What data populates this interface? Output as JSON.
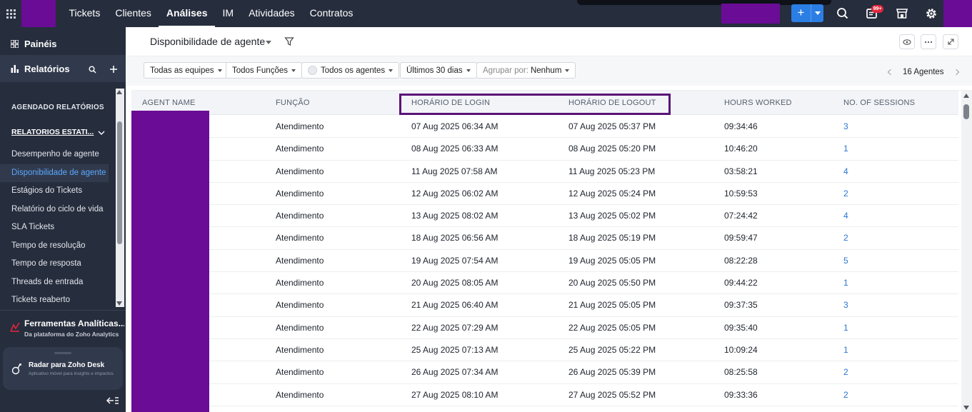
{
  "topbar": {
    "nav": [
      {
        "label": "Tickets",
        "active": false
      },
      {
        "label": "Clientes",
        "active": false
      },
      {
        "label": "Análises",
        "active": true
      },
      {
        "label": "IM",
        "active": false
      },
      {
        "label": "Atividades",
        "active": false
      },
      {
        "label": "Contratos",
        "active": false
      }
    ],
    "new_button": "+",
    "notification_badge": "99+",
    "icons": [
      "apps-grid-icon",
      "search-icon",
      "notifications-icon",
      "marketplace-icon",
      "settings-icon"
    ],
    "colors": {
      "bar": "#262d3d",
      "accent": "#2b7ee4",
      "redacted": "#6a0c96",
      "badge": "#e0263b"
    }
  },
  "sidebar": {
    "paineis_label": "Painéis",
    "relatorios_label": "Relatórios",
    "section_scheduled": "AGENDADO RELATÓRIOS",
    "section_static": "RELATORIOS ESTATI...",
    "items": [
      {
        "label": "Desempenho de agente",
        "active": false
      },
      {
        "label": "Disponibilidade de agente",
        "active": true
      },
      {
        "label": "Estágios do Tickets",
        "active": false
      },
      {
        "label": "Relatório do ciclo de vida",
        "active": false
      },
      {
        "label": "SLA Tickets",
        "active": false
      },
      {
        "label": "Tempo de resolução",
        "active": false
      },
      {
        "label": "Tempo de resposta",
        "active": false
      },
      {
        "label": "Threads de entrada",
        "active": false
      },
      {
        "label": "Tickets reaberto",
        "active": false
      }
    ],
    "analytics_title": "Ferramentas Analíticas...",
    "analytics_subtitle": "Da plataforma do Zoho Analytics",
    "radar_title": "Radar para Zoho Desk",
    "radar_subtitle": "Aplicativo móvel para insights e impactos"
  },
  "page": {
    "title": "Disponibilidade de agente"
  },
  "filters": {
    "teams": "Todas as equipes",
    "roles": "Todos Funções",
    "agents": "Todos os agentes",
    "period": "Últimos 30 dias",
    "group_by_label": "Agrupar por:",
    "group_by_value": "Nenhum",
    "agents_count": "16 Agentes"
  },
  "table": {
    "headers": [
      "AGENT NAME",
      "FUNÇÃO",
      "HORÁRIO DE LOGIN",
      "HORÁRIO DE LOGOUT",
      "HOURS WORKED",
      "NO. OF SESSIONS"
    ],
    "rows": [
      {
        "role": "Atendimento",
        "login": "07 Aug 2025 06:34 AM",
        "logout": "07 Aug 2025 05:37 PM",
        "hours": "09:34:46",
        "sessions": "3"
      },
      {
        "role": "Atendimento",
        "login": "08 Aug 2025 06:33 AM",
        "logout": "08 Aug 2025 05:20 PM",
        "hours": "10:46:20",
        "sessions": "1"
      },
      {
        "role": "Atendimento",
        "login": "11 Aug 2025 07:58 AM",
        "logout": "11 Aug 2025 05:23 PM",
        "hours": "03:58:21",
        "sessions": "4"
      },
      {
        "role": "Atendimento",
        "login": "12 Aug 2025 06:02 AM",
        "logout": "12 Aug 2025 05:24 PM",
        "hours": "10:59:53",
        "sessions": "2"
      },
      {
        "role": "Atendimento",
        "login": "13 Aug 2025 08:02 AM",
        "logout": "13 Aug 2025 05:02 PM",
        "hours": "07:24:42",
        "sessions": "4"
      },
      {
        "role": "Atendimento",
        "login": "18 Aug 2025 06:56 AM",
        "logout": "18 Aug 2025 05:19 PM",
        "hours": "09:59:47",
        "sessions": "2"
      },
      {
        "role": "Atendimento",
        "login": "19 Aug 2025 07:54 AM",
        "logout": "19 Aug 2025 05:05 PM",
        "hours": "08:22:28",
        "sessions": "5"
      },
      {
        "role": "Atendimento",
        "login": "20 Aug 2025 08:05 AM",
        "logout": "20 Aug 2025 05:50 PM",
        "hours": "09:44:22",
        "sessions": "1"
      },
      {
        "role": "Atendimento",
        "login": "21 Aug 2025 06:40 AM",
        "logout": "21 Aug 2025 05:05 PM",
        "hours": "09:37:35",
        "sessions": "3"
      },
      {
        "role": "Atendimento",
        "login": "22 Aug 2025 07:29 AM",
        "logout": "22 Aug 2025 05:05 PM",
        "hours": "09:35:40",
        "sessions": "1"
      },
      {
        "role": "Atendimento",
        "login": "25 Aug 2025 07:13 AM",
        "logout": "25 Aug 2025 05:22 PM",
        "hours": "10:09:24",
        "sessions": "1"
      },
      {
        "role": "Atendimento",
        "login": "26 Aug 2025 07:34 AM",
        "logout": "26 Aug 2025 05:39 PM",
        "hours": "08:25:58",
        "sessions": "2"
      },
      {
        "role": "Atendimento",
        "login": "27 Aug 2025 08:10 AM",
        "logout": "27 Aug 2025 05:52 PM",
        "hours": "09:33:36",
        "sessions": "2"
      }
    ]
  }
}
